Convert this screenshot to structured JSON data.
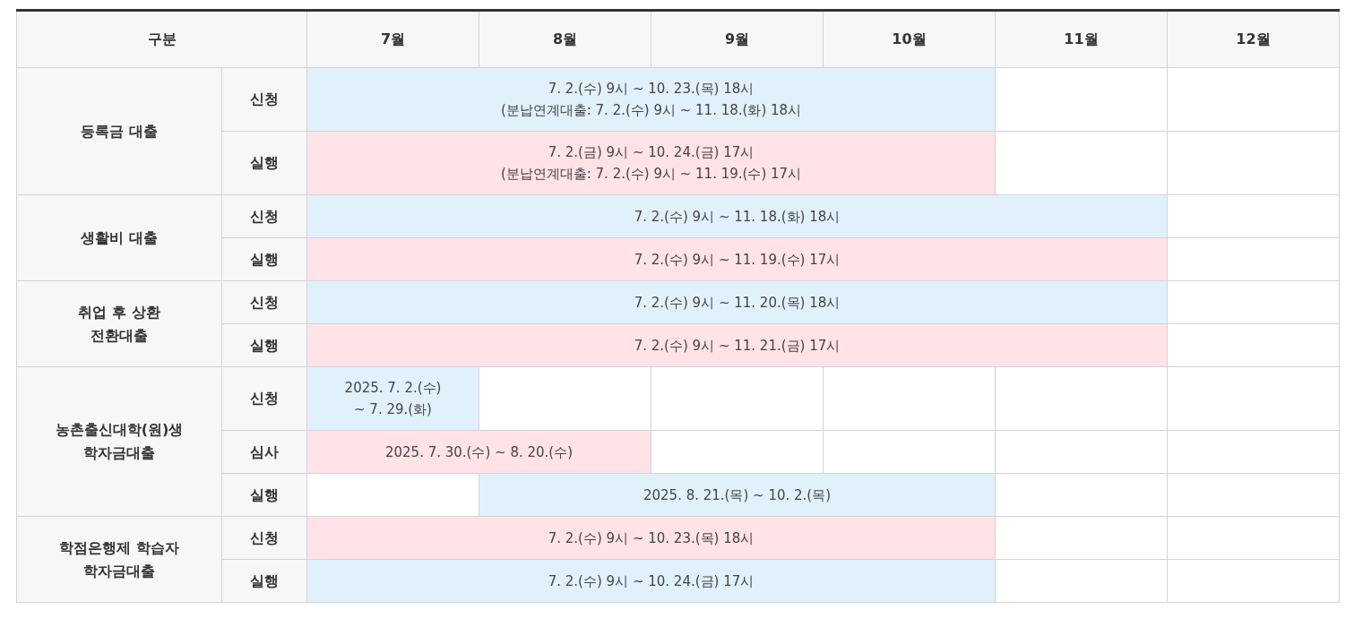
{
  "table": {
    "header": {
      "category": "구분",
      "months": [
        "7월",
        "8월",
        "9월",
        "10월",
        "11월",
        "12월"
      ]
    },
    "categories": [
      {
        "lines": [
          "등록금 대출"
        ],
        "stages": [
          {
            "label": "신청",
            "cells": [
              {
                "kind": "period",
                "lines": [
                  "7. 2.(수) 9시 ~ 10. 23.(목) 18시",
                  "(분납연계대출: 7. 2.(수) 9시 ~ 11. 18.(화) 18시"
                ],
                "color": "#e0f1fb"
              },
              {
                "kind": "continued"
              },
              {
                "kind": "continued"
              },
              {
                "kind": "continued"
              },
              {
                "kind": "empty"
              },
              {
                "kind": "empty"
              }
            ]
          },
          {
            "label": "실행",
            "cells": [
              {
                "kind": "period",
                "lines": [
                  "7. 2.(금) 9시 ~ 10. 24.(금) 17시",
                  "(분납연계대출: 7. 2.(수) 9시 ~ 11. 19.(수) 17시"
                ],
                "color": "#ffe3e6"
              },
              {
                "kind": "continued"
              },
              {
                "kind": "continued"
              },
              {
                "kind": "continued"
              },
              {
                "kind": "empty"
              },
              {
                "kind": "empty"
              }
            ]
          }
        ]
      },
      {
        "lines": [
          "생활비 대출"
        ],
        "stages": [
          {
            "label": "신청",
            "cells": [
              {
                "kind": "period",
                "lines": [
                  "7. 2.(수) 9시 ~ 11. 18.(화) 18시"
                ],
                "color": "#e0f1fb"
              },
              {
                "kind": "continued"
              },
              {
                "kind": "continued"
              },
              {
                "kind": "continued"
              },
              {
                "kind": "continued"
              },
              {
                "kind": "empty"
              }
            ]
          },
          {
            "label": "실행",
            "cells": [
              {
                "kind": "period",
                "lines": [
                  "7. 2.(수) 9시 ~ 11. 19.(수) 17시"
                ],
                "color": "#ffe3e6"
              },
              {
                "kind": "continued"
              },
              {
                "kind": "continued"
              },
              {
                "kind": "continued"
              },
              {
                "kind": "continued"
              },
              {
                "kind": "empty"
              }
            ]
          }
        ]
      },
      {
        "lines": [
          "취업 후 상환",
          "전환대출"
        ],
        "stages": [
          {
            "label": "신청",
            "cells": [
              {
                "kind": "period",
                "lines": [
                  "7. 2.(수) 9시 ~ 11. 20.(목) 18시"
                ],
                "color": "#e0f1fb"
              },
              {
                "kind": "continued"
              },
              {
                "kind": "continued"
              },
              {
                "kind": "continued"
              },
              {
                "kind": "continued"
              },
              {
                "kind": "empty"
              }
            ]
          },
          {
            "label": "실행",
            "cells": [
              {
                "kind": "period",
                "lines": [
                  "7. 2.(수) 9시 ~ 11. 21.(금) 17시"
                ],
                "color": "#ffe3e6"
              },
              {
                "kind": "continued"
              },
              {
                "kind": "continued"
              },
              {
                "kind": "continued"
              },
              {
                "kind": "continued"
              },
              {
                "kind": "empty"
              }
            ]
          }
        ]
      },
      {
        "lines": [
          "농촌출신대학(원)생",
          "학자금대출"
        ],
        "stages": [
          {
            "label": "신청",
            "cells": [
              {
                "kind": "period",
                "lines": [
                  "2025. 7. 2.(수)",
                  "~ 7. 29.(화)"
                ],
                "color": "#e0f1fb"
              },
              {
                "kind": "empty"
              },
              {
                "kind": "empty"
              },
              {
                "kind": "empty"
              },
              {
                "kind": "empty"
              },
              {
                "kind": "empty"
              }
            ]
          },
          {
            "label": "심사",
            "cells": [
              {
                "kind": "period",
                "lines": [
                  "2025. 7. 30.(수) ~ 8. 20.(수)"
                ],
                "color": "#ffe3e6"
              },
              {
                "kind": "continued"
              },
              {
                "kind": "empty"
              },
              {
                "kind": "empty"
              },
              {
                "kind": "empty"
              },
              {
                "kind": "empty"
              }
            ]
          },
          {
            "label": "실행",
            "cells": [
              {
                "kind": "empty"
              },
              {
                "kind": "period",
                "lines": [
                  "2025. 8. 21.(목) ~ 10. 2.(목)"
                ],
                "color": "#e0f1fb"
              },
              {
                "kind": "continued"
              },
              {
                "kind": "continued"
              },
              {
                "kind": "empty"
              },
              {
                "kind": "empty"
              }
            ]
          }
        ]
      },
      {
        "lines": [
          "학점은행제 학습자",
          "학자금대출"
        ],
        "stages": [
          {
            "label": "신청",
            "cells": [
              {
                "kind": "period",
                "lines": [
                  "7. 2.(수) 9시 ~ 10. 23.(목) 18시"
                ],
                "color": "#ffe3e6"
              },
              {
                "kind": "continued"
              },
              {
                "kind": "continued"
              },
              {
                "kind": "continued"
              },
              {
                "kind": "empty"
              },
              {
                "kind": "empty"
              }
            ]
          },
          {
            "label": "실행",
            "cells": [
              {
                "kind": "period",
                "lines": [
                  "7. 2.(수) 9시 ~ 10. 24.(금) 17시"
                ],
                "color": "#e0f1fb"
              },
              {
                "kind": "continued"
              },
              {
                "kind": "continued"
              },
              {
                "kind": "continued"
              },
              {
                "kind": "empty"
              },
              {
                "kind": "empty"
              }
            ]
          }
        ]
      }
    ]
  }
}
